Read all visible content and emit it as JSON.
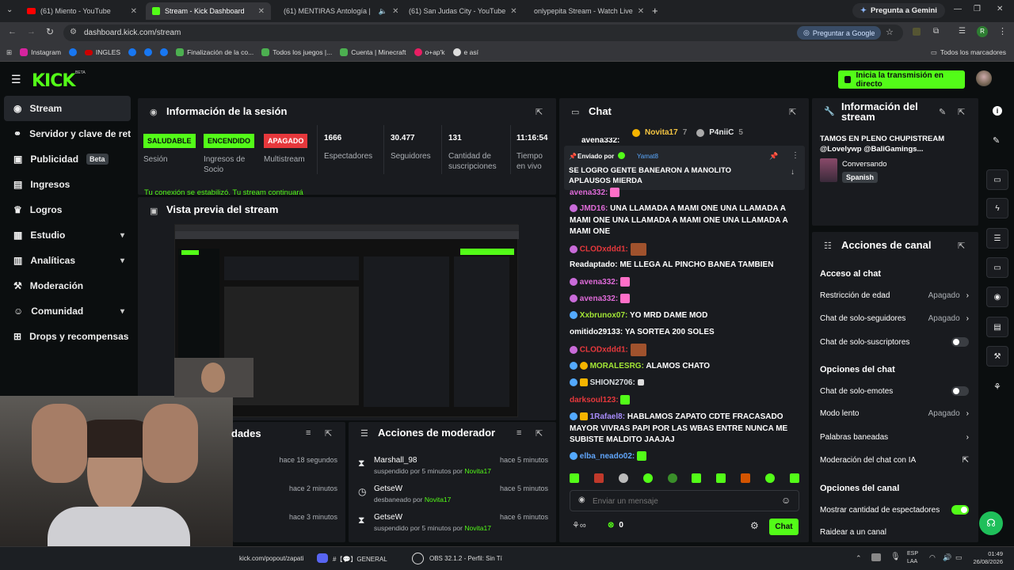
{
  "browser": {
    "tabs": [
      {
        "label": "(61) Miento - YouTube"
      },
      {
        "label": "Stream - Kick Dashboard"
      },
      {
        "label": "(61) MENTIRAS Antología |"
      },
      {
        "label": "(61) San Judas City - YouTube"
      },
      {
        "label": "onlypepita Stream - Watch Live"
      }
    ],
    "gemini": "Pregunta a Gemini",
    "url": "dashboard.kick.com/stream",
    "google_btn": "Preguntar a Google",
    "avatar_letter": "R",
    "bookmarks": [
      "Instagram",
      "INGLES",
      "Finalización de la co...",
      "Todos los juegos |...",
      "Cuenta | Minecraft",
      "o+ap'k",
      "e así"
    ],
    "all_bookmarks": "Todos los marcadores"
  },
  "header": {
    "logo": "KICK",
    "logo_beta": "BETA",
    "go_live": "Inicia la transmisión en directo"
  },
  "sidebar": {
    "items": [
      {
        "label": "Stream"
      },
      {
        "label": "Servidor y clave de retransmisión"
      },
      {
        "label": "Publicidad",
        "badge": "Beta"
      },
      {
        "label": "Ingresos"
      },
      {
        "label": "Logros"
      },
      {
        "label": "Estudio"
      },
      {
        "label": "Analíticas"
      },
      {
        "label": "Moderación"
      },
      {
        "label": "Comunidad"
      },
      {
        "label": "Drops y recompensas"
      }
    ]
  },
  "session": {
    "title": "Información de la sesión",
    "stats": [
      {
        "value": "SALUDABLE",
        "label": "Sesión",
        "color": "#53fc18"
      },
      {
        "value": "ENCENDIDO",
        "label": "Ingresos de Socio",
        "color": "#53fc18"
      },
      {
        "value": "APAGADO",
        "label": "Multistream",
        "color": "#e6383c"
      },
      {
        "value": "1666",
        "label": "Espectadores"
      },
      {
        "value": "30.477",
        "label": "Seguidores"
      },
      {
        "value": "131",
        "label": "Cantidad de suscripciones"
      },
      {
        "value": "11:16:54",
        "label": "Tiempo en vivo"
      }
    ],
    "notice": "Tu conexión se estabilizó. Tu stream continuará"
  },
  "preview": {
    "title": "Vista previa del stream"
  },
  "activity": {
    "title_fragment": "dades",
    "times": [
      "hace 18 segundos",
      "hace 2 minutos",
      "hace 3 minutos"
    ]
  },
  "modactions": {
    "title": "Acciones de moderador",
    "rows": [
      {
        "user": "Marshall_98",
        "action": "suspendido por 5 minutos por",
        "by": "Novita17",
        "time": "hace 5 minutos"
      },
      {
        "user": "GetseW",
        "action": "desbaneado por",
        "by": "Novita17",
        "time": "hace 5 minutos"
      },
      {
        "user": "GetseW",
        "action": "suspendido por 5 minutos por",
        "by": "Novita17",
        "time": "hace 6 minutos"
      }
    ]
  },
  "chat": {
    "title": "Chat",
    "top_users": [
      {
        "name": "Novita17",
        "count": "7"
      },
      {
        "name": "P4niiC",
        "count": "5"
      }
    ],
    "pinned": {
      "label": "Enviado por",
      "user": "Yamat8",
      "text": "SE LOGRO GENTE BANEARON A MANOLITO APLAUSOS MIERDA",
      "prev_user": "avena332:"
    },
    "messages": [
      {
        "user": "avena332:",
        "text": "",
        "color": "#e06bd9"
      },
      {
        "user": "JMD16:",
        "text": "UNA LLAMADA A MAMI ONE  UNA LLAMADA A MAMI ONE  UNA LLAMADA A MAMI ONE  UNA LLAMADA A MAMI ONE",
        "color": "#e06bd9"
      },
      {
        "user": "CLODxddd1:",
        "text": "",
        "color": "#e6383c"
      },
      {
        "user": "Readaptado:",
        "text": "ME LLEGA AL PINCHO BANEA TAMBIEN",
        "color": "#ffffff"
      },
      {
        "user": "avena332:",
        "text": "",
        "color": "#e06bd9"
      },
      {
        "user": "avena332:",
        "text": "",
        "color": "#e06bd9"
      },
      {
        "user": "Xxbrunox07:",
        "text": "YO MRD DAME MOD",
        "color": "#a3e635"
      },
      {
        "user": "omitido29133:",
        "text": "YA SORTEA 200 SOLES",
        "color": "#ffffff"
      },
      {
        "user": "CLODxddd1:",
        "text": "",
        "color": "#e6383c"
      },
      {
        "user": "MORALESRG:",
        "text": "ALAMOS CHATO",
        "color": "#a3e635"
      },
      {
        "user": "SHION2706:",
        "text": "",
        "color": "#d9dde0"
      },
      {
        "user": "darksoul123:",
        "text": "",
        "color": "#e6383c"
      },
      {
        "user": "1Rafael8:",
        "text": "HABLAMOS ZAPATO CDTE FRACASADO MAYOR VIVRAS PAPI POR LAS WBAS ENTRE NUNCA ME SUBISTE MALDITO JAAJAJ",
        "color": "#a78bfa"
      },
      {
        "user": "elba_neado02:",
        "text": "",
        "color": "#60a5fa"
      }
    ],
    "input_placeholder": "Enviar un mensaje",
    "points": "0",
    "send": "Chat"
  },
  "stream_info": {
    "title": "Información del stream",
    "stream_title": "TAMOS EN PLENO CHUPISTREAM @Lovelywp @BaliGamings...",
    "category": "Conversando",
    "language": "Spanish"
  },
  "channel_actions": {
    "title": "Acciones de canal",
    "sections": [
      {
        "heading": "Acceso al chat"
      },
      {
        "heading": "Opciones del chat"
      },
      {
        "heading": "Opciones del canal"
      }
    ],
    "rows": [
      {
        "label": "Restricción de edad",
        "value": "Apagado"
      },
      {
        "label": "Chat de solo-seguidores",
        "value": "Apagado"
      },
      {
        "label": "Chat de solo-suscriptores",
        "toggle": false
      },
      {
        "label": "Chat de solo-emotes",
        "toggle": false
      },
      {
        "label": "Modo lento",
        "value": "Apagado"
      },
      {
        "label": "Palabras baneadas"
      },
      {
        "label": "Moderación del chat con IA"
      },
      {
        "label": "Mostrar cantidad de espectadores",
        "toggle": true
      },
      {
        "label": "Raidear a un canal"
      }
    ]
  },
  "taskbar": {
    "item1": "kick.com/popout/zapati",
    "item2": "#【💬】GENERAL",
    "item3": "OBS 32.1.2 - Perfil: Sin Tí",
    "lang": "ESP",
    "lang2": "LAA",
    "time": "01:49",
    "date": "26/08/2026"
  }
}
